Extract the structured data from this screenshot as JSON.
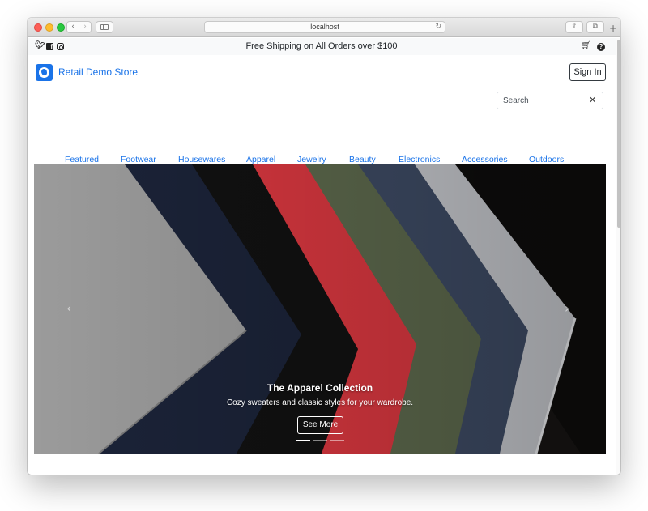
{
  "browser": {
    "url": "localhost",
    "icons": {
      "back": "chevron-left-icon",
      "forward": "chevron-right-icon",
      "sidebar": "sidebar-icon",
      "reload": "reload-icon",
      "share": "share-icon",
      "tabs": "tabs-icon",
      "new_tab": "plus-icon"
    }
  },
  "topbar": {
    "promo": "Free Shipping on All Orders over $100",
    "social": [
      "twitter-icon",
      "facebook-icon",
      "instagram-icon"
    ],
    "right_icons": [
      "cart-icon",
      "help-icon"
    ]
  },
  "header": {
    "brand": "Retail Demo Store",
    "brand_color": "#1a73e8",
    "signin_label": "Sign In",
    "search_placeholder": "Search"
  },
  "categories": [
    "Featured",
    "Footwear",
    "Housewares",
    "Apparel",
    "Jewelry",
    "Beauty",
    "Electronics",
    "Accessories",
    "Outdoors"
  ],
  "hero": {
    "title": "The Apparel Collection",
    "subtitle": "Cozy sweaters and classic styles for your wardrobe.",
    "button": "See More",
    "slides": 3,
    "active_slide": 1,
    "fabric_colors": [
      "#9b9b9b",
      "#1b2338",
      "#111111",
      "#d8373f",
      "#5c684c",
      "#3d4a63",
      "#c5c7cc"
    ]
  }
}
